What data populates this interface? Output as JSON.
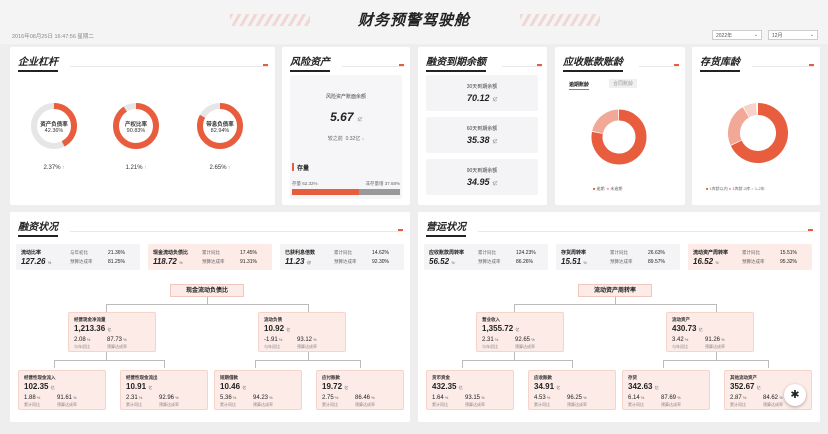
{
  "header": {
    "title": "财务预警驾驶舱",
    "datetime": "2016年08月25日 16:47:56 星期二",
    "year_select": "2022年",
    "month_select": "12月"
  },
  "colors": {
    "accent": "#e85d3e",
    "accent_light": "#f2a897",
    "bg": "#eeeeee"
  },
  "leverage": {
    "title": "企业杠杆",
    "gauges": [
      {
        "name": "资产负债率",
        "value": "42.36%",
        "pct": 0.4236,
        "change": "2.37%"
      },
      {
        "name": "产权比率",
        "value": "90.83%",
        "pct": 0.9083,
        "change": "1.21%"
      },
      {
        "name": "带息负债率",
        "value": "82.94%",
        "pct": 0.8294,
        "change": "2.65%"
      }
    ]
  },
  "risk": {
    "title": "风险资产",
    "card_label": "风险资产账面余额",
    "card_value": "5.67",
    "card_unit": "亿",
    "compare_label": "较之前",
    "compare_value": "0.32亿",
    "stock_label": "存量",
    "bar_left_label": "存量 62.32%",
    "bar_right_label": "非存量增 37.68%",
    "bar_left_pct": 0.6232
  },
  "financing": {
    "title": "融资到期余额",
    "items": [
      {
        "label": "30天到期余额",
        "value": "70.12",
        "unit": "亿"
      },
      {
        "label": "60天到期余额",
        "value": "35.38",
        "unit": "亿"
      },
      {
        "label": "90天到期余额",
        "value": "34.95",
        "unit": "亿"
      }
    ]
  },
  "receivable": {
    "title": "应收账款账龄",
    "tab_active": "逾期账龄",
    "tab_inactive": "合同账龄",
    "legend": [
      "逾期",
      "未逾期"
    ],
    "donut_pct": 0.78
  },
  "inventory": {
    "title": "存货库龄",
    "legend": [
      "1库龄以内",
      "1库龄-2库",
      "1-2年"
    ],
    "donut_pct": 0.68
  },
  "financing_status": {
    "title": "融资状况",
    "kpis": [
      {
        "label": "流动比率",
        "value": "127.26",
        "unit": "%",
        "l1": "与年初比",
        "v1": "21.36%",
        "l2": "预算达成率",
        "v2": "81.25%",
        "pink": false
      },
      {
        "label": "现金流动负债比",
        "value": "118.72",
        "unit": "%",
        "l1": "累计同比",
        "v1": "17.45%",
        "l2": "预算达成率",
        "v2": "91.31%",
        "pink": true
      },
      {
        "label": "已获利息倍数",
        "value": "11.23",
        "unit": "倍",
        "l1": "累计同比",
        "v1": "14.62%",
        "l2": "预算达成率",
        "v2": "92.30%",
        "pink": false
      }
    ],
    "tree_root": "现金流动负债比",
    "level1": [
      {
        "name": "经营现金净流量",
        "value": "1,213.36",
        "unit": "亿",
        "r1": "2.08",
        "r1l": "与年初比",
        "r2": "87.73",
        "r2l": "预算达成率"
      },
      {
        "name": "流动负债",
        "value": "10.92",
        "unit": "亿",
        "r1": "-1.91",
        "r1l": "与年初比",
        "r2": "93.12",
        "r2l": "预算达成率"
      }
    ],
    "level2": [
      {
        "name": "经营性现金流入",
        "value": "102.35",
        "unit": "亿",
        "r1": "1.88",
        "r1l": "累计同比",
        "r2": "91.61",
        "r2l": "预算达成率"
      },
      {
        "name": "经营性现金流出",
        "value": "10.91",
        "unit": "亿",
        "r1": "2.31",
        "r1l": "累计同比",
        "r2": "92.96",
        "r2l": "预算达成率"
      },
      {
        "name": "短期借款",
        "value": "10.46",
        "unit": "亿",
        "r1": "5.36",
        "r1l": "累计同比",
        "r2": "94.23",
        "r2l": "预算达成率"
      },
      {
        "name": "应付账款",
        "value": "19.72",
        "unit": "亿",
        "r1": "2.75",
        "r1l": "累计同比",
        "r2": "86.46",
        "r2l": "预算达成率"
      }
    ]
  },
  "operation_status": {
    "title": "营运状况",
    "kpis": [
      {
        "label": "应收账款周转率",
        "value": "56.52",
        "unit": "%",
        "l1": "累计同比",
        "v1": "124.23%",
        "l2": "预算达成率",
        "v2": "86.26%",
        "pink": false
      },
      {
        "label": "存货周转率",
        "value": "15.51",
        "unit": "%",
        "l1": "累计同比",
        "v1": "26.63%",
        "l2": "预算达成率",
        "v2": "89.57%",
        "pink": false
      },
      {
        "label": "流动资产周转率",
        "value": "16.52",
        "unit": "%",
        "l1": "累计同比",
        "v1": "15.51%",
        "l2": "预算达成率",
        "v2": "95.32%",
        "pink": true
      }
    ],
    "tree_root": "流动资产周转率",
    "level1": [
      {
        "name": "营业收入",
        "value": "1,355.72",
        "unit": "亿",
        "r1": "2.31",
        "r1l": "与年初比",
        "r2": "92.65",
        "r2l": "预算达成率"
      },
      {
        "name": "流动资产",
        "value": "430.73",
        "unit": "亿",
        "r1": "3.42",
        "r1l": "与年初比",
        "r2": "91.26",
        "r2l": "预算达成率"
      }
    ],
    "level2": [
      {
        "name": "货币资金",
        "value": "432.35",
        "unit": "亿",
        "r1": "1.64",
        "r1l": "累计同比",
        "r2": "93.15",
        "r2l": "预算达成率"
      },
      {
        "name": "应收账款",
        "value": "34.91",
        "unit": "亿",
        "r1": "4.53",
        "r1l": "累计同比",
        "r2": "96.25",
        "r2l": "预算达成率"
      },
      {
        "name": "存货",
        "value": "342.63",
        "unit": "亿",
        "r1": "6.14",
        "r1l": "累计同比",
        "r2": "87.69",
        "r2l": "预算达成率"
      },
      {
        "name": "其他流动资产",
        "value": "352.67",
        "unit": "亿",
        "r1": "2.87",
        "r1l": "累计同比",
        "r2": "84.62",
        "r2l": "预算达成率"
      }
    ]
  }
}
